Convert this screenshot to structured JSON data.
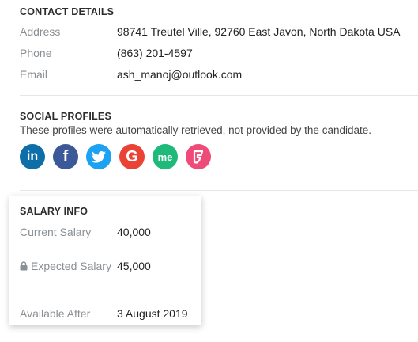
{
  "contact": {
    "title": "CONTACT DETAILS",
    "address_label": "Address",
    "address_value": "98741 Treutel Ville, 92760 East Javon, North Dakota USA",
    "phone_label": "Phone",
    "phone_value": "(863) 201-4597",
    "email_label": "Email",
    "email_value": "ash_manoj@outlook.com"
  },
  "social": {
    "title": "SOCIAL PROFILES",
    "subtitle": "These profiles were automatically retrieved, not provided by the candidate.",
    "profiles": [
      {
        "icon": "linkedin-icon",
        "text": "in",
        "color": "#0e6fa8"
      },
      {
        "icon": "facebook-icon",
        "text": "f",
        "color": "#3b5998"
      },
      {
        "icon": "twitter-icon",
        "text": "",
        "color": "#1da1f2"
      },
      {
        "icon": "google-icon",
        "text": "G",
        "color": "#ea4335"
      },
      {
        "icon": "aboutme-icon",
        "text": "me",
        "color": "#1fba7a"
      },
      {
        "icon": "foursquare-icon",
        "text": "",
        "color": "#ef4b78"
      }
    ]
  },
  "salary": {
    "title": "SALARY INFO",
    "current_label": "Current Salary",
    "current_value": "40,000",
    "expected_label": "Expected Salary",
    "expected_value": "45,000",
    "available_label": "Available After",
    "available_value": "3 August 2019"
  }
}
